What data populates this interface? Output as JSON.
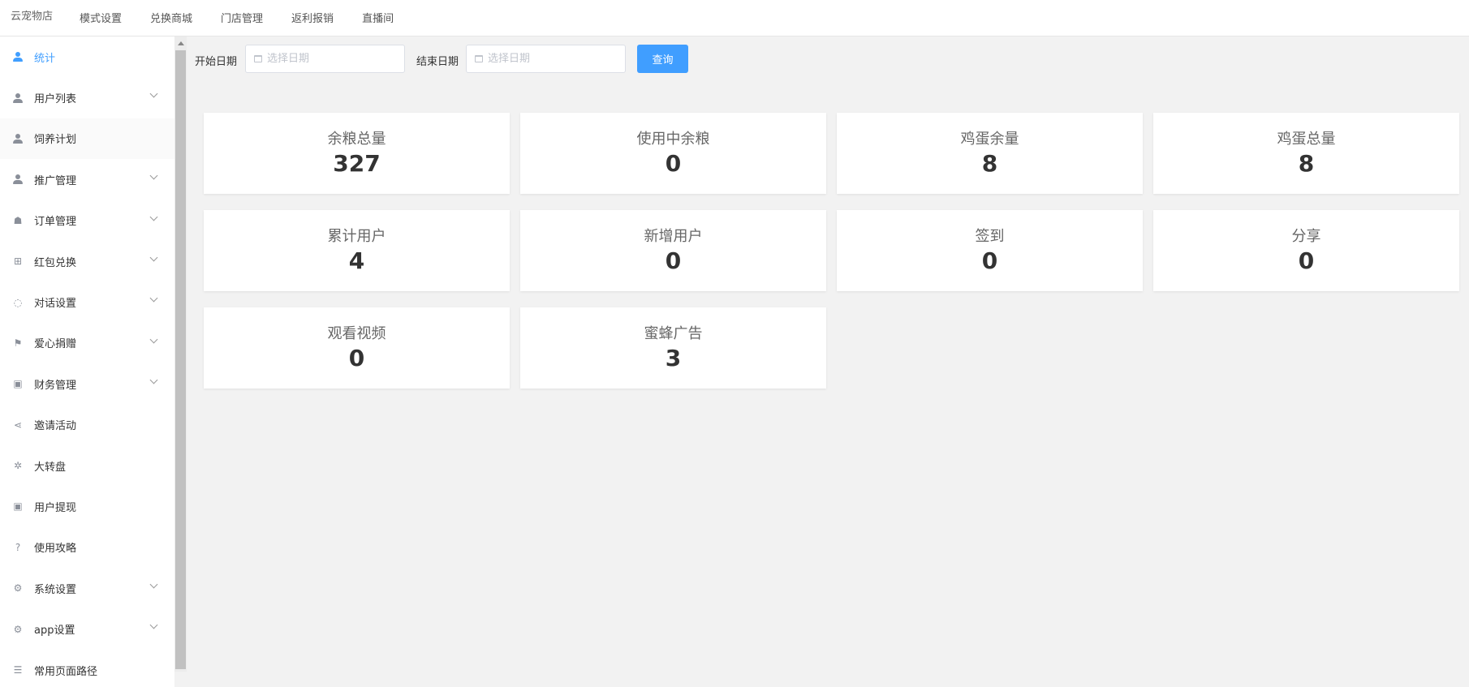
{
  "header": {
    "brand": "云宠物店",
    "nav": [
      "模式设置",
      "兑换商城",
      "门店管理",
      "返利报销",
      "直播间"
    ]
  },
  "sidebar": {
    "items": [
      {
        "label": "统计",
        "icon": "user-icon",
        "glyph": "",
        "submenu": false,
        "active": true
      },
      {
        "label": "用户列表",
        "icon": "user-icon",
        "glyph": "",
        "submenu": true
      },
      {
        "label": "饲养计划",
        "icon": "user-icon",
        "glyph": "",
        "submenu": false,
        "hover": true
      },
      {
        "label": "推广管理",
        "icon": "user-icon",
        "glyph": "",
        "submenu": true
      },
      {
        "label": "订单管理",
        "icon": "shopping-bag-icon",
        "glyph": "☗",
        "submenu": true
      },
      {
        "label": "红包兑换",
        "icon": "gift-icon",
        "glyph": "⊞",
        "submenu": true
      },
      {
        "label": "对话设置",
        "icon": "chat-icon",
        "glyph": "◌",
        "submenu": true
      },
      {
        "label": "爱心捐赠",
        "icon": "flag-icon",
        "glyph": "⚑",
        "submenu": true
      },
      {
        "label": "财务管理",
        "icon": "wallet-icon",
        "glyph": "▣",
        "submenu": true
      },
      {
        "label": "邀请活动",
        "icon": "share-icon",
        "glyph": "⋖",
        "submenu": false
      },
      {
        "label": "大转盘",
        "icon": "wheel-icon",
        "glyph": "✲",
        "submenu": false
      },
      {
        "label": "用户提现",
        "icon": "wallet-icon",
        "glyph": "▣",
        "submenu": false
      },
      {
        "label": "使用攻略",
        "icon": "help-icon",
        "glyph": "?",
        "submenu": false
      },
      {
        "label": "系统设置",
        "icon": "gear-icon",
        "glyph": "⚙",
        "submenu": true
      },
      {
        "label": "app设置",
        "icon": "gear-icon",
        "glyph": "⚙",
        "submenu": true
      },
      {
        "label": "常用页面路径",
        "icon": "list-icon",
        "glyph": "☰",
        "submenu": false
      }
    ]
  },
  "filter": {
    "start_label": "开始日期",
    "end_label": "结束日期",
    "start_placeholder": "选择日期",
    "end_placeholder": "选择日期",
    "start_value": "",
    "end_value": "",
    "query_label": "查询"
  },
  "stats": [
    {
      "label": "余粮总量",
      "value": "327"
    },
    {
      "label": "使用中余粮",
      "value": "0"
    },
    {
      "label": "鸡蛋余量",
      "value": "8"
    },
    {
      "label": "鸡蛋总量",
      "value": "8"
    },
    {
      "label": "累计用户",
      "value": "4"
    },
    {
      "label": "新增用户",
      "value": "0"
    },
    {
      "label": "签到",
      "value": "0"
    },
    {
      "label": "分享",
      "value": "0"
    },
    {
      "label": "观看视频",
      "value": "0"
    },
    {
      "label": "蜜蜂广告",
      "value": "3"
    }
  ],
  "colors": {
    "accent": "#409eff",
    "background": "#f2f2f2"
  }
}
